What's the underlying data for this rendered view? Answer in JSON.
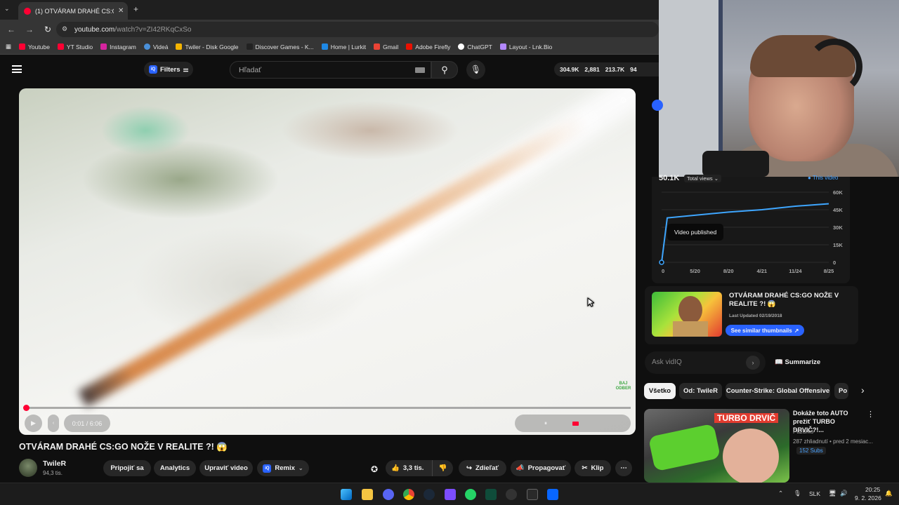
{
  "browser": {
    "tab_title": "(1) OTVÁRAM DRAHÉ CS:GO N...",
    "url_domain": "youtube.com",
    "url_path": "/watch?v=ZI42RKqCxSo",
    "bookmarks": [
      "Youtube",
      "YT Studio",
      "Instagram",
      "Videá",
      "Twiler - Disk Google",
      "Discover Games - K...",
      "Home | Lurkit",
      "Gmail",
      "Adobe Firefly",
      "ChatGPT",
      "Layout - Lnk.Bio"
    ]
  },
  "header": {
    "filters_label": "Filters",
    "search_placeholder": "Hľadať",
    "stats": [
      "304.9K",
      "2,881",
      "213.7K",
      "94"
    ]
  },
  "player": {
    "time": "0:01 / 6:06",
    "progress": 0.003,
    "buffered": 0.05,
    "watermark": "BAJ ODBER"
  },
  "video": {
    "title": "OTVÁRAM DRAHÉ CS:GO NOŽE V REALITE ?! 😱",
    "channel": "TwileR",
    "subs": "94,3 tis.",
    "join_label": "Pripojiť sa",
    "analytics_label": "Analytics",
    "edit_label": "Upraviť video",
    "remix_label": "Remix",
    "likes": "3,3 tis.",
    "share_label": "Zdieľať",
    "promote_label": "Propagovať",
    "clip_label": "Klip"
  },
  "vidiq": {
    "views_value": "50.1K",
    "views_select": "Total views",
    "legend": "This video",
    "tooltip": "Video published",
    "y_ticks": [
      "60K",
      "45K",
      "30K",
      "15K",
      "0"
    ],
    "x_ticks": [
      "0",
      "5/20",
      "8/20",
      "4/21",
      "11/24",
      "8/25"
    ],
    "thumb_title": "OTVÁRAM DRAHÉ CS:GO NOŽE V REALITE ?! 😱",
    "last_updated": "Last Updated 02/19/2018",
    "see_similar": "See similar thumbnails",
    "ask_placeholder": "Ask vidIQ",
    "summarize_label": "Summarize"
  },
  "chips": [
    "Všetko",
    "Od: TwileR",
    "Counter-Strike: Global Offensive",
    "Po"
  ],
  "recommended": {
    "title": "Dokáže toto AUTO prežiť TURBO DRVIČ?!...",
    "channel": "Pazúrko",
    "meta": "287 zhliadnutí • pred 2 mesiac...",
    "subs_badge": "152 Subs",
    "thumb_text": "TURBO DRVIČ"
  },
  "taskbar": {
    "lang": "SLK",
    "time": "20:25",
    "date": "9. 2. 2026"
  },
  "chart_data": {
    "type": "line",
    "x": [
      "0",
      "5/20",
      "8/20",
      "4/21",
      "11/24",
      "8/25"
    ],
    "series": [
      {
        "values": [
          0,
          38000,
          43000,
          45000,
          48000,
          50100
        ]
      }
    ],
    "ylim": [
      0,
      60000
    ]
  }
}
